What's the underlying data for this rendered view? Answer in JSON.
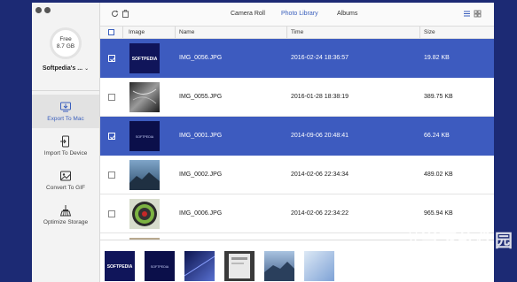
{
  "sidebar": {
    "storage": {
      "line1": "Free",
      "line2": "8.7 GB"
    },
    "device_name": "Softpedia's ...",
    "items": [
      {
        "label": "Export To Mac",
        "icon": "export-to-mac-icon",
        "active": true
      },
      {
        "label": "Import To Device",
        "icon": "import-to-device-icon",
        "active": false
      },
      {
        "label": "Convert To GIF",
        "icon": "convert-to-gif-icon",
        "active": false
      },
      {
        "label": "Optimize Storage",
        "icon": "optimize-storage-icon",
        "active": false
      }
    ]
  },
  "topbar": {
    "tabs": [
      "Camera Roll",
      "Photo Library",
      "Albums"
    ],
    "active_tab": "Photo Library",
    "left_icons": [
      "refresh-icon",
      "trash-icon"
    ],
    "right_icons": [
      "list-view-icon",
      "grid-view-icon"
    ]
  },
  "table": {
    "columns": [
      "Image",
      "Name",
      "Time",
      "Size"
    ],
    "rows": [
      {
        "name": "IMG_0056.JPG",
        "time": "2016-02-24 18:36:57",
        "size": "19.82 KB",
        "selected": true,
        "thumb_text": "SOFTPEDIA"
      },
      {
        "name": "IMG_0055.JPG",
        "time": "2016-01-28 18:38:19",
        "size": "389.75 KB",
        "selected": false,
        "thumb_text": ""
      },
      {
        "name": "IMG_0001.JPG",
        "time": "2014-09-06 20:48:41",
        "size": "66.24 KB",
        "selected": true,
        "thumb_text": "SOFTPEDIA"
      },
      {
        "name": "IMG_0002.JPG",
        "time": "2014-02-06 22:34:34",
        "size": "489.02 KB",
        "selected": false,
        "thumb_text": ""
      },
      {
        "name": "IMG_0006.JPG",
        "time": "2014-02-06 22:34:22",
        "size": "965.94 KB",
        "selected": false,
        "thumb_text": ""
      }
    ]
  },
  "strip": {
    "thumbs": [
      "SOFTPEDIA",
      "SOFTPEDIA",
      "",
      "",
      "",
      ""
    ]
  },
  "watermark": {
    "text": "当下软件园",
    "url": "www.downxia.com"
  },
  "colors": {
    "accent": "#3d5bbf",
    "background": "#1c2a74"
  }
}
